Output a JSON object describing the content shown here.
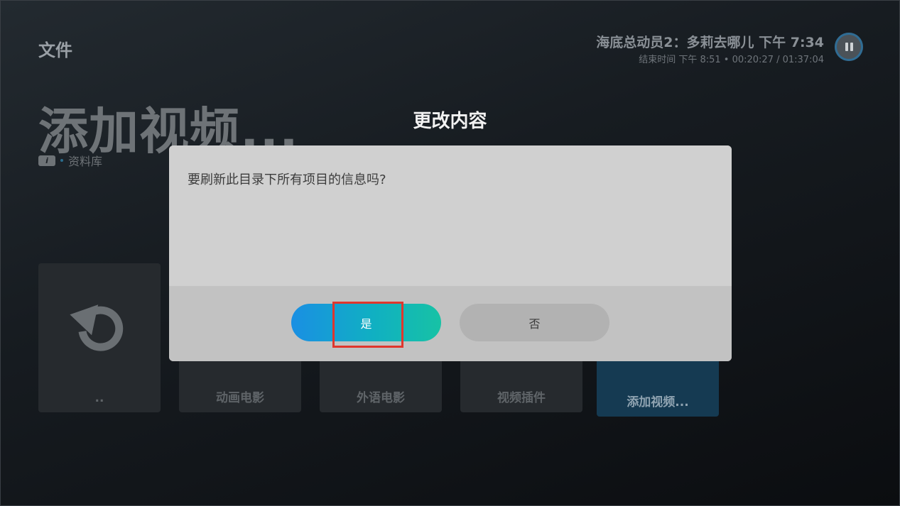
{
  "header": {
    "section_title": "文件",
    "now_playing_title": "海底总动员2：多莉去哪儿 下午 7:34",
    "now_playing_subtitle": "结束时间 下午 8:51 • 00:20:27 / 01:37:04"
  },
  "main": {
    "page_title": "添加视频...",
    "info_badge": "i",
    "breadcrumb_label": "资料库",
    "tiles": [
      {
        "label": "..",
        "icon": "back-arrow-icon"
      },
      {
        "label": "动画电影"
      },
      {
        "label": "外语电影"
      },
      {
        "label": "视频插件"
      },
      {
        "label": "添加视频..."
      }
    ]
  },
  "dialog": {
    "title": "更改内容",
    "message": "要刷新此目录下所有项目的信息吗?",
    "yes_label": "是",
    "no_label": "否"
  },
  "colors": {
    "accent_start": "#1a8fe3",
    "accent_end": "#17c2a5",
    "highlight": "#e0362c"
  }
}
